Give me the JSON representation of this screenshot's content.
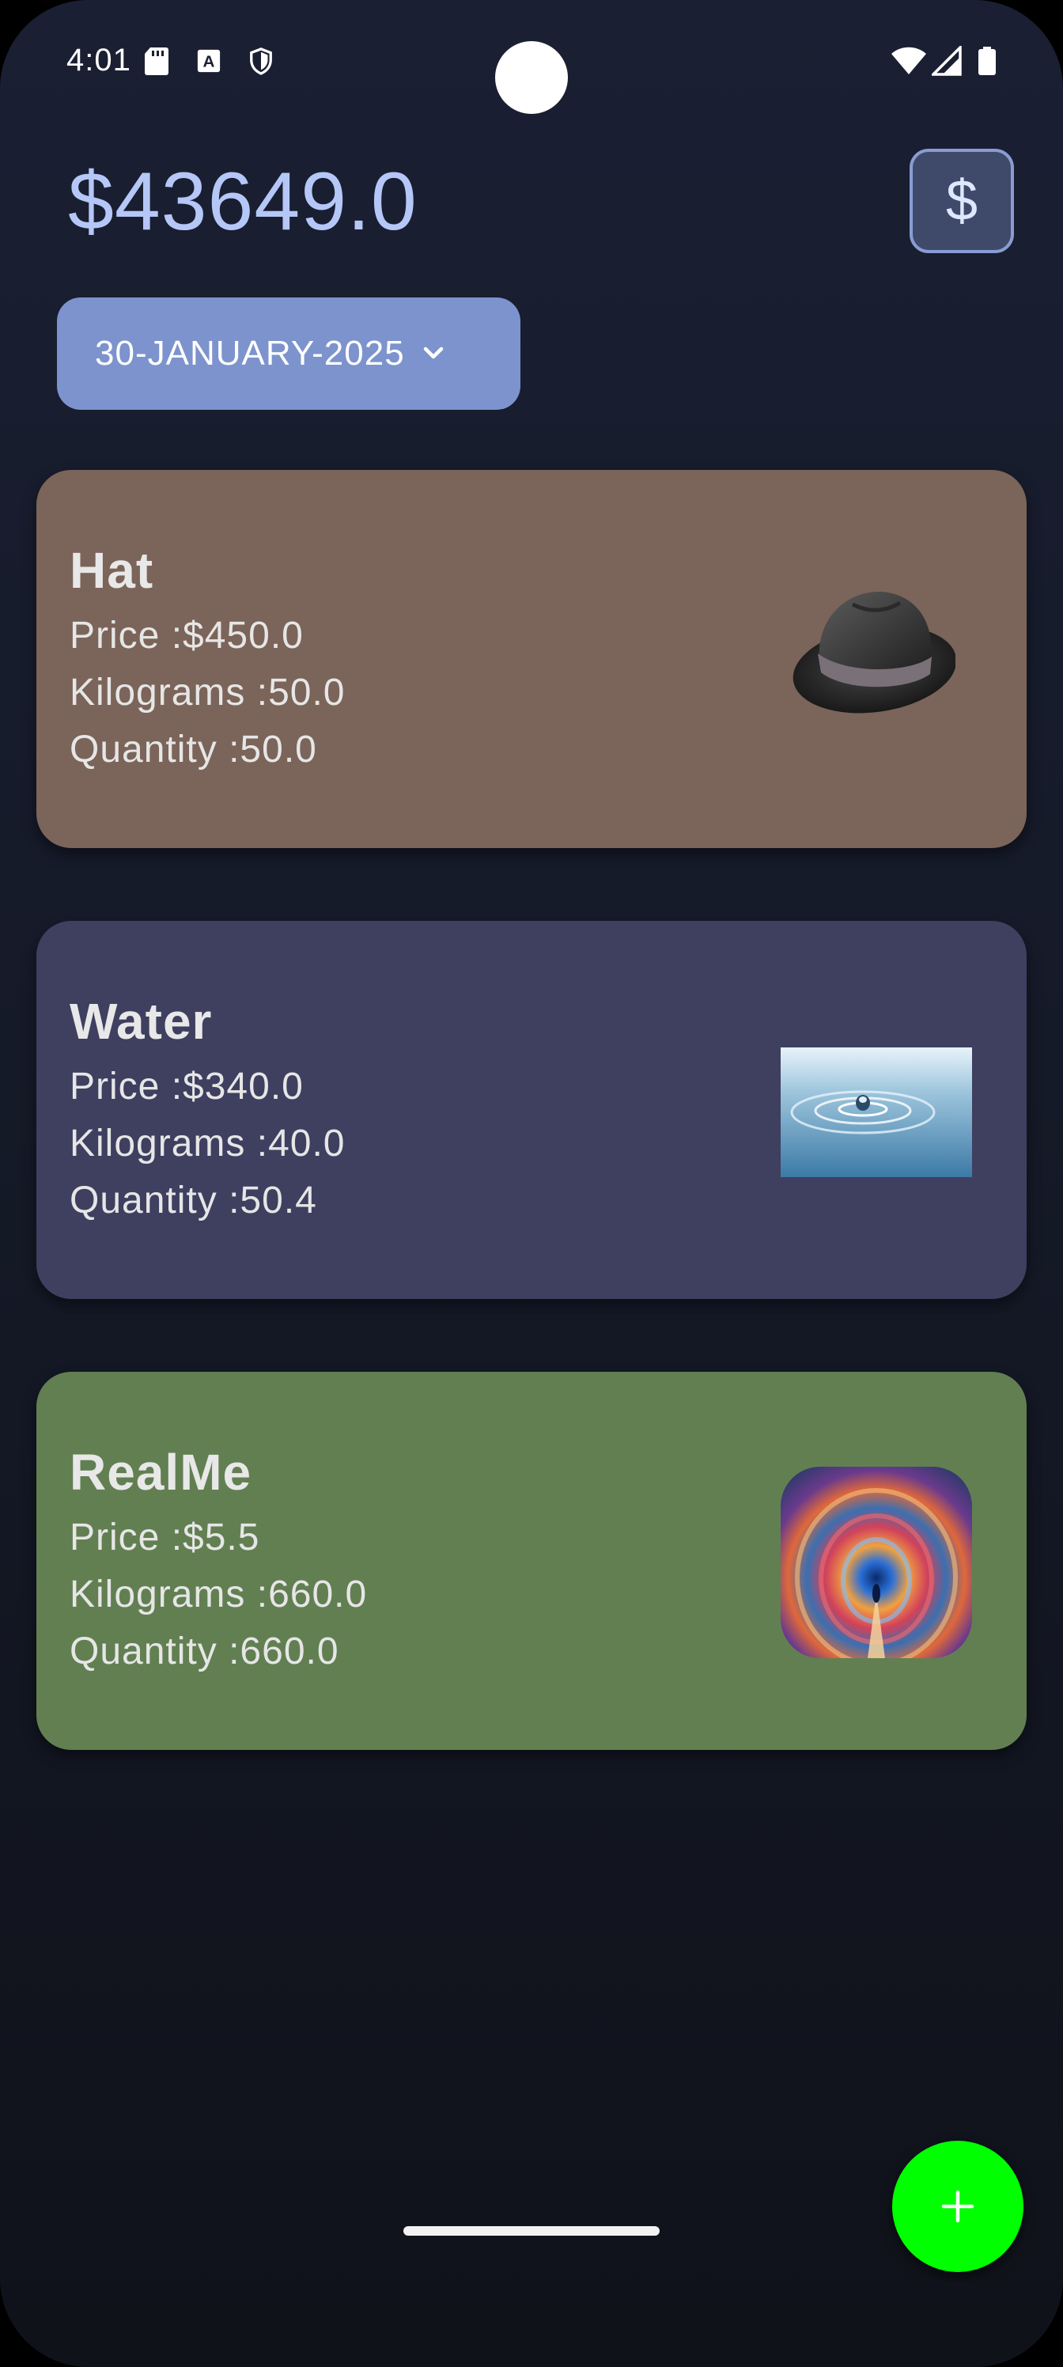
{
  "status_bar": {
    "time": "4:01",
    "icons": [
      "sd-card-icon",
      "keyboard-a-icon",
      "shield-icon",
      "wifi-icon",
      "cell-signal-icon",
      "battery-icon"
    ]
  },
  "header": {
    "balance": "$43649.0",
    "currency_button_label": "$"
  },
  "date_selector": {
    "label": "30-JANUARY-2025",
    "icon": "chevron-down-icon"
  },
  "items": [
    {
      "name": "Hat",
      "price": "Price :$450.0",
      "kilograms": "Kilograms :50.0",
      "quantity": "Quantity :50.0",
      "color": "#7b6459",
      "image": "hat-image"
    },
    {
      "name": "Water",
      "price": "Price :$340.0",
      "kilograms": "Kilograms :40.0",
      "quantity": "Quantity :50.4",
      "color": "#3f3f60",
      "image": "water-drop-image"
    },
    {
      "name": "RealMe",
      "price": "Price :$5.5",
      "kilograms": "Kilograms :660.0",
      "quantity": "Quantity :660.0",
      "color": "#627f52",
      "image": "swirl-portal-image"
    }
  ],
  "fab": {
    "icon": "plus-icon",
    "color": "#00ff00"
  }
}
